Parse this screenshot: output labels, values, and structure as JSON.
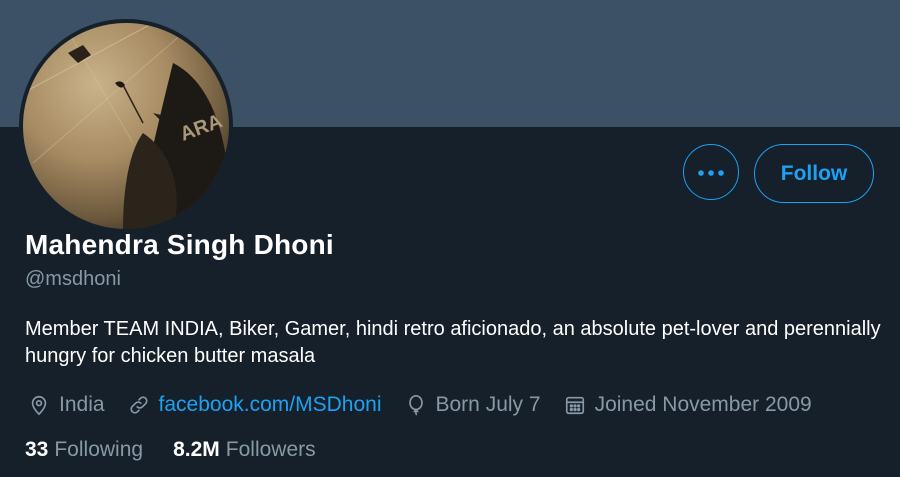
{
  "profile": {
    "name": "Mahendra Singh Dhoni",
    "handle": "@msdhoni",
    "bio": "Member TEAM INDIA, Biker, Gamer, hindi retro aficionado, an absolute pet-lover and perennially hungry for chicken butter masala"
  },
  "actions": {
    "more_label": "•••",
    "follow_label": "Follow"
  },
  "meta": {
    "location": "India",
    "location_icon": "location-pin-icon",
    "website": "facebook.com/MSDhoni",
    "website_icon": "link-icon",
    "birthday": "Born July 7",
    "birthday_icon": "balloon-icon",
    "joined": "Joined November 2009",
    "joined_icon": "calendar-icon"
  },
  "stats": {
    "following_count": "33",
    "following_label": "Following",
    "followers_count": "8.2M",
    "followers_label": "Followers"
  },
  "colors": {
    "background": "#15202b",
    "banner": "#3d5166",
    "accent": "#1da1f2",
    "secondary_text": "#8899a6"
  }
}
